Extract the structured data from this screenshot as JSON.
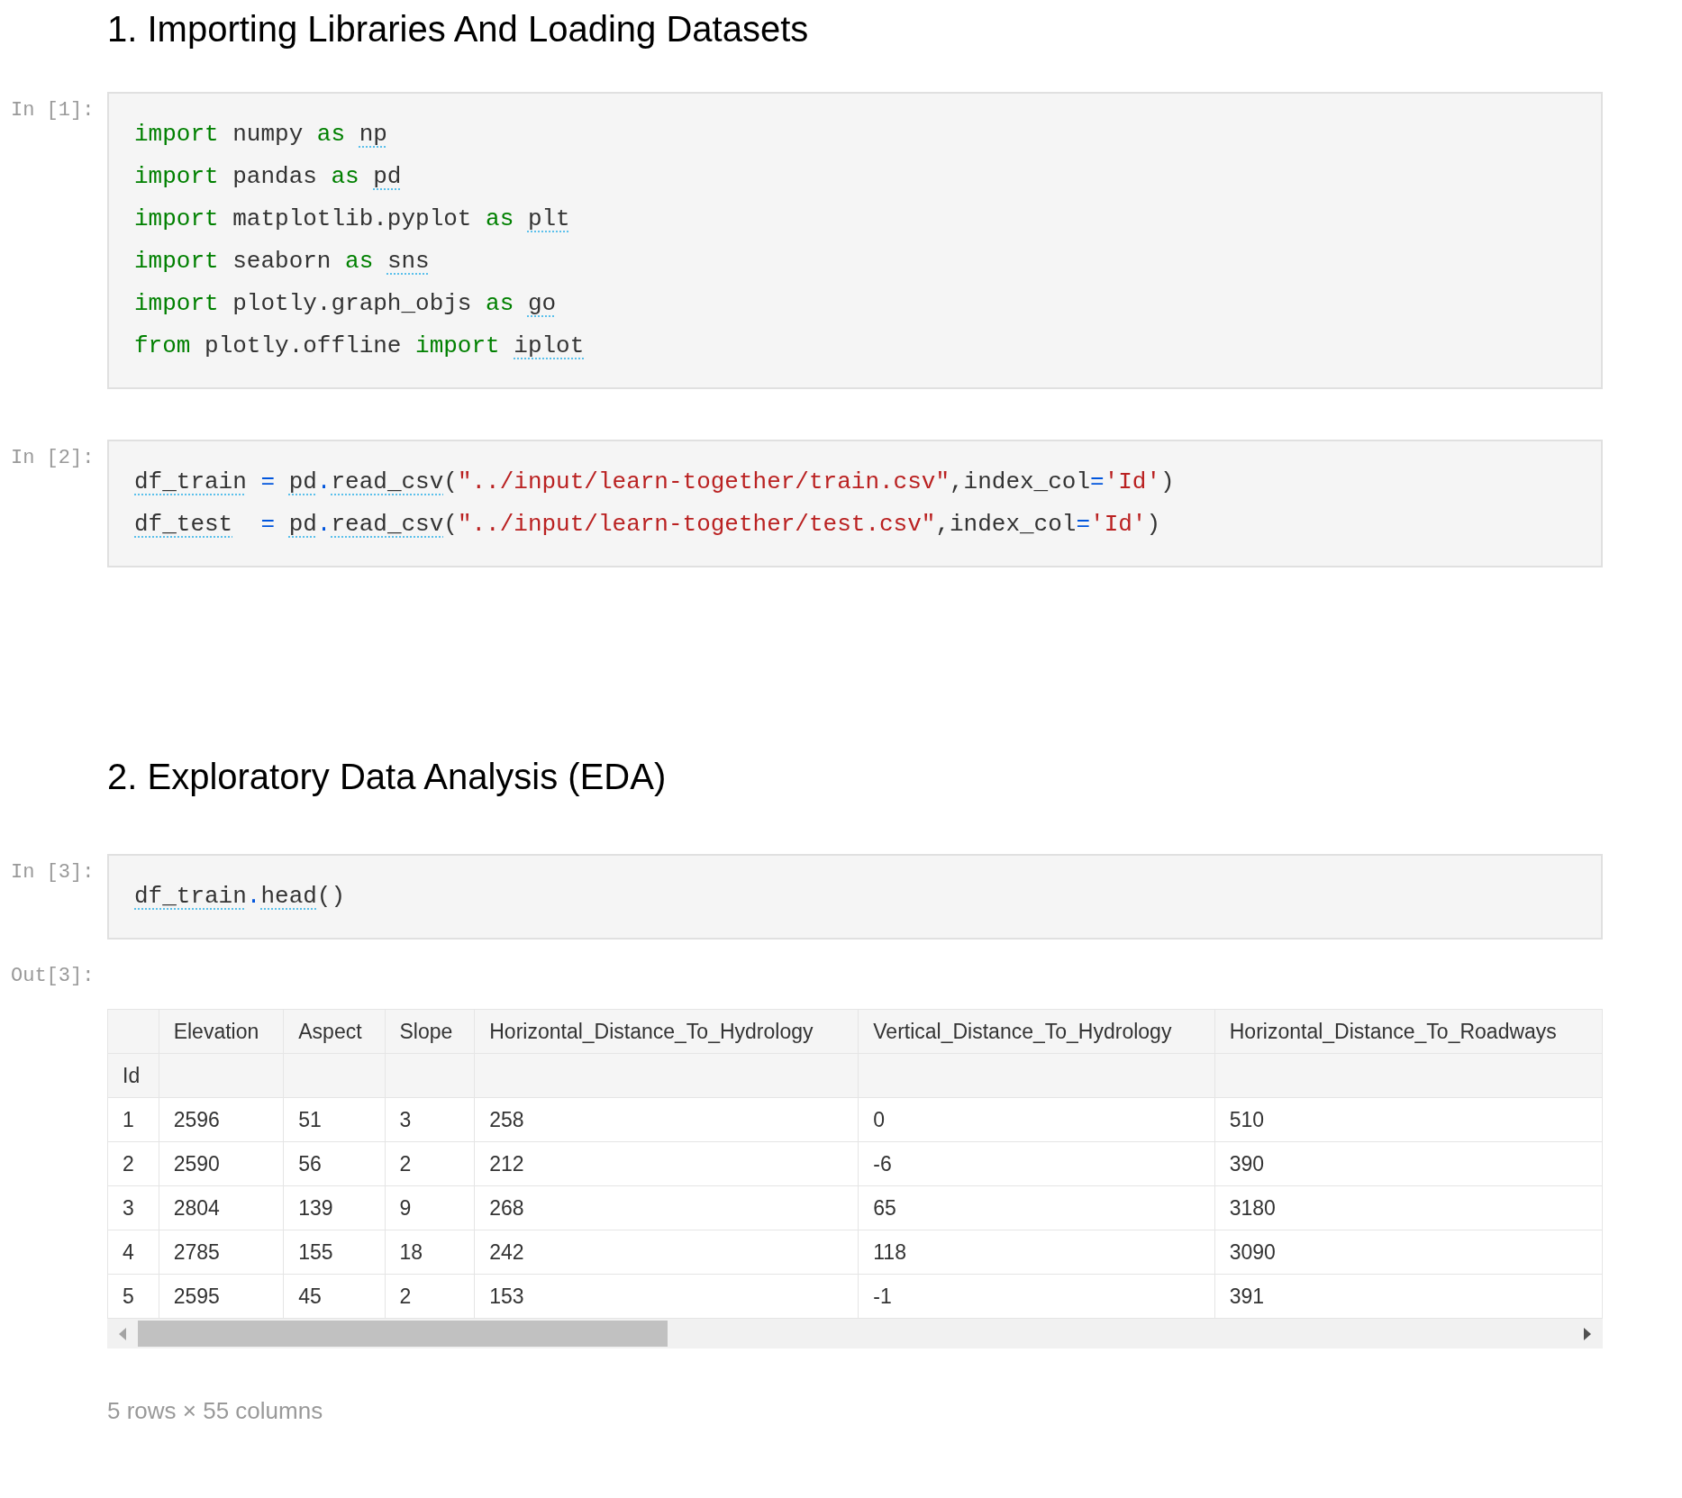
{
  "cells": [
    {
      "kind": "heading",
      "text": "1. Importing Libraries And Loading Datasets"
    },
    {
      "kind": "code",
      "prompt": "In [1]:",
      "lines": [
        [
          {
            "text": "import",
            "kind": "keyword"
          },
          {
            "text": " numpy ",
            "kind": "plain"
          },
          {
            "text": "as ",
            "kind": "keyword"
          },
          {
            "text": "np",
            "kind": "name"
          }
        ],
        [
          {
            "text": "import",
            "kind": "keyword"
          },
          {
            "text": " pandas ",
            "kind": "plain"
          },
          {
            "text": "as ",
            "kind": "keyword"
          },
          {
            "text": "pd",
            "kind": "name"
          }
        ],
        [
          {
            "text": "import",
            "kind": "keyword"
          },
          {
            "text": " matplotlib.pyplot ",
            "kind": "plain"
          },
          {
            "text": "as ",
            "kind": "keyword"
          },
          {
            "text": "plt",
            "kind": "name"
          }
        ],
        [
          {
            "text": "import",
            "kind": "keyword"
          },
          {
            "text": " seaborn ",
            "kind": "plain"
          },
          {
            "text": "as ",
            "kind": "keyword"
          },
          {
            "text": "sns",
            "kind": "name"
          }
        ],
        [
          {
            "text": "import",
            "kind": "keyword"
          },
          {
            "text": " plotly.graph_objs ",
            "kind": "plain"
          },
          {
            "text": "as ",
            "kind": "keyword"
          },
          {
            "text": "go",
            "kind": "name"
          }
        ],
        [
          {
            "text": "from",
            "kind": "keyword"
          },
          {
            "text": " plotly.offline ",
            "kind": "plain"
          },
          {
            "text": "import ",
            "kind": "keyword"
          },
          {
            "text": "iplot",
            "kind": "name"
          }
        ]
      ]
    },
    {
      "kind": "code",
      "prompt": "In [2]:",
      "lines": [
        [
          {
            "text": "df_train",
            "kind": "name"
          },
          {
            "text": " = ",
            "kind": "operator"
          },
          {
            "text": "pd",
            "kind": "name"
          },
          {
            "text": ".",
            "kind": "operator"
          },
          {
            "text": "read_csv",
            "kind": "name"
          },
          {
            "text": "(",
            "kind": "plain"
          },
          {
            "text": "\"../input/learn-together/train.csv\"",
            "kind": "string"
          },
          {
            "text": ",index_col",
            "kind": "plain"
          },
          {
            "text": "=",
            "kind": "operator"
          },
          {
            "text": "'Id'",
            "kind": "string"
          },
          {
            "text": ")",
            "kind": "plain"
          }
        ],
        [
          {
            "text": "df_test",
            "kind": "name"
          },
          {
            "text": "  = ",
            "kind": "operator"
          },
          {
            "text": "pd",
            "kind": "name"
          },
          {
            "text": ".",
            "kind": "operator"
          },
          {
            "text": "read_csv",
            "kind": "name"
          },
          {
            "text": "(",
            "kind": "plain"
          },
          {
            "text": "\"../input/learn-together/test.csv\"",
            "kind": "string"
          },
          {
            "text": ",index_col",
            "kind": "plain"
          },
          {
            "text": "=",
            "kind": "operator"
          },
          {
            "text": "'Id'",
            "kind": "string"
          },
          {
            "text": ")",
            "kind": "plain"
          }
        ]
      ]
    },
    {
      "kind": "spacer"
    },
    {
      "kind": "heading",
      "text": "2. Exploratory Data Analysis (EDA)"
    },
    {
      "kind": "code",
      "prompt": "In [3]:",
      "lines": [
        [
          {
            "text": "df_train",
            "kind": "name"
          },
          {
            "text": ".",
            "kind": "operator"
          },
          {
            "text": "head",
            "kind": "name"
          },
          {
            "text": "()",
            "kind": "plain"
          }
        ]
      ]
    },
    {
      "kind": "output",
      "prompt": "Out[3]:",
      "table": {
        "columns": [
          null,
          "Elevation",
          "Aspect",
          "Slope",
          "Horizontal_Distance_To_Hydrology",
          "Vertical_Distance_To_Hydrology",
          "Horizontal_Distance_To_Roadways"
        ],
        "index_name": "Id",
        "rows": [
          [
            "1",
            "2596",
            "51",
            "3",
            "258",
            "0",
            "510"
          ],
          [
            "2",
            "2590",
            "56",
            "2",
            "212",
            "-6",
            "390"
          ],
          [
            "3",
            "2804",
            "139",
            "9",
            "268",
            "65",
            "3180"
          ],
          [
            "4",
            "2785",
            "155",
            "18",
            "242",
            "118",
            "3090"
          ],
          [
            "5",
            "2595",
            "45",
            "2",
            "153",
            "-1",
            "391"
          ]
        ]
      },
      "footer": "5 rows × 55 columns"
    }
  ]
}
